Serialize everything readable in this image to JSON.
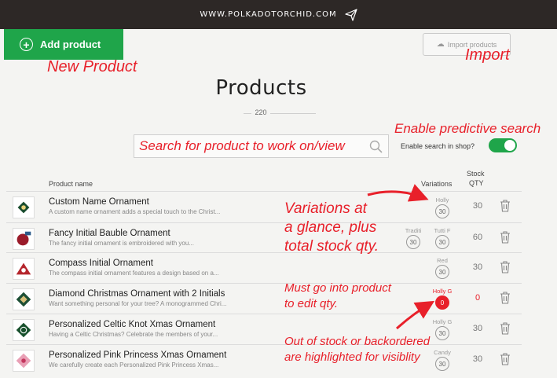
{
  "topbar": {
    "url": "WWW.POLKADOTORCHID.COM",
    "send_icon": "send-icon"
  },
  "actions": {
    "add_label": "Add product",
    "import_label": "Import products"
  },
  "page": {
    "title": "Products",
    "count": "220"
  },
  "search": {
    "placeholder": "Search for product to work on/view",
    "toggle_label": "Enable search in shop?",
    "toggle_on": true
  },
  "columns": {
    "name": "Product name",
    "variations": "Variations",
    "stock_line1": "Stock",
    "stock_line2": "QTY"
  },
  "products": [
    {
      "name": "Custom Name Ornament",
      "desc": "A custom name ornament adds a special touch to the Christ...",
      "variations": [
        {
          "label": "Holly",
          "count": "30",
          "alert": false
        }
      ],
      "stock": "30",
      "stock_alert": false
    },
    {
      "name": "Fancy Initial Bauble Ornament",
      "desc": "The fancy initial ornament is embroidered with you...",
      "variations": [
        {
          "label": "Traditi",
          "count": "30",
          "alert": false
        },
        {
          "label": "Tutti F",
          "count": "30",
          "alert": false
        }
      ],
      "stock": "60",
      "stock_alert": false
    },
    {
      "name": "Compass Initial Ornament",
      "desc": "The compass initial ornament features a design based on a...",
      "variations": [
        {
          "label": "Red",
          "count": "30",
          "alert": false
        }
      ],
      "stock": "30",
      "stock_alert": false
    },
    {
      "name": "Diamond Christmas Ornament with 2 Initials",
      "desc": "Want something personal for your tree? A monogrammed Chri...",
      "variations": [
        {
          "label": "Holly G",
          "count": "0",
          "alert": true
        }
      ],
      "stock": "0",
      "stock_alert": true
    },
    {
      "name": "Personalized Celtic Knot Xmas Ornament",
      "desc": "Having a Celtic Christmas? Celebrate the members of your...",
      "variations": [
        {
          "label": "Holly G",
          "count": "30",
          "alert": false
        }
      ],
      "stock": "30",
      "stock_alert": false
    },
    {
      "name": "Personalized Pink Princess Xmas Ornament",
      "desc": "We carefully create each Personalized Pink Princess Xmas...",
      "variations": [
        {
          "label": "Candy",
          "count": "30",
          "alert": false
        }
      ],
      "stock": "30",
      "stock_alert": false
    }
  ],
  "annotations": {
    "new_product": "New Product",
    "import": "Import",
    "predictive": "Enable predictive search",
    "variations_1": "Variations at",
    "variations_2": "a glance, plus",
    "variations_3": "total stock qty.",
    "edit_1": "Must go into product",
    "edit_2": "to edit qty.",
    "oos_1": "Out of stock or backordered",
    "oos_2": "are highlighted for visiblity"
  },
  "colors": {
    "accent_green": "#1fa54a",
    "annotation_red": "#e8202a",
    "topbar": "#2d2826"
  }
}
